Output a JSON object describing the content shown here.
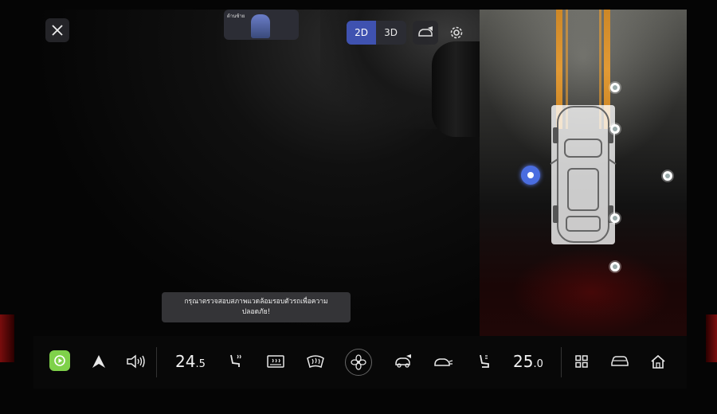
{
  "top_controls": {
    "preview_label": "ด้านซ้าย",
    "view_modes": [
      {
        "label": "2D",
        "selected": true
      },
      {
        "label": "3D",
        "selected": false
      }
    ]
  },
  "toast": {
    "line1": "กรุณาตรวจสอบสภาพแวดล้อมรอบตัวรถเพื่อความ",
    "line2": "ปลอดภัย!"
  },
  "bottom_bar": {
    "driver_temp_main": "24",
    "driver_temp_decimal": ".5",
    "passenger_temp_main": "25",
    "passenger_temp_decimal": ".0"
  },
  "colors": {
    "accent_blue": "#3f52b0",
    "guide_orange": "#f0a030",
    "carplay_green": "#7fd14a",
    "warning_red": "#7a0d0d"
  },
  "icons": [
    "close-icon",
    "camera-angle-icon",
    "gear-icon",
    "carplay-icon",
    "navigation-icon",
    "volume-icon",
    "seat-heat-icon",
    "rear-defrost-icon",
    "front-defrost-icon",
    "fan-icon",
    "car-view-icon",
    "car-lights-icon",
    "seat-icon",
    "apps-grid-icon",
    "car-icon",
    "home-icon"
  ]
}
